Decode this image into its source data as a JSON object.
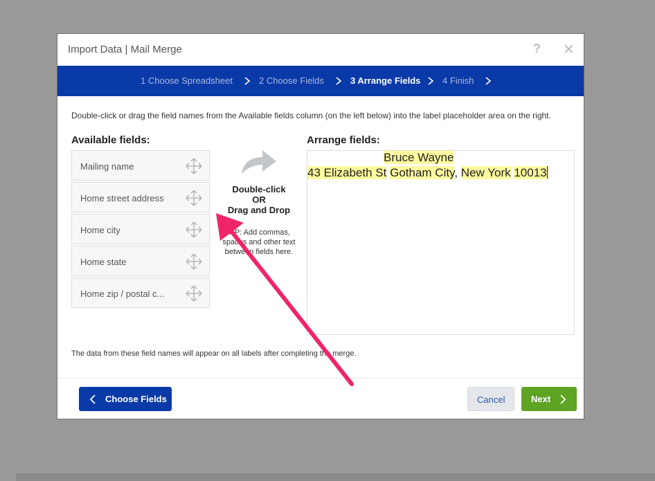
{
  "dialog": {
    "title": "Import Data | Mail Merge",
    "help_icon": "question-mark-icon",
    "close_icon": "close-icon"
  },
  "steps": [
    {
      "label": "1 Choose Spreadsheet",
      "active": false
    },
    {
      "label": "2 Choose Fields",
      "active": false
    },
    {
      "label": "3 Arrange Fields",
      "active": true
    },
    {
      "label": "4 Finish",
      "active": false
    }
  ],
  "instructions": "Double-click or drag the field names from the Available fields column (on the left below) into the label placeholder area on the right.",
  "available_fields": {
    "heading": "Available fields:",
    "items": [
      "Mailing name",
      "Home street address",
      "Home city",
      "Home state",
      "Home zip / postal c..."
    ]
  },
  "middle": {
    "line1": "Double-click",
    "line2": "OR",
    "line3": "Drag and Drop",
    "tip1": "TIP: Add commas,",
    "tip2": "spaces and other text",
    "tip3": "between fields here."
  },
  "arrange_fields": {
    "heading": "Arrange fields:",
    "line1": "Bruce Wayne",
    "street": "43 Elizabeth St",
    "city": "Gotham City",
    "sep": ",",
    "state": "New York",
    "zip": "10013"
  },
  "footer_note": "The data from these field names will appear on all labels after completing the merge.",
  "buttons": {
    "back": "Choose Fields",
    "cancel": "Cancel",
    "next": "Next"
  },
  "colors": {
    "steps_bar": "#0a3aa8",
    "next_button": "#5fa323",
    "highlight": "#fffa9e",
    "annotation_arrow": "#f0246a"
  }
}
